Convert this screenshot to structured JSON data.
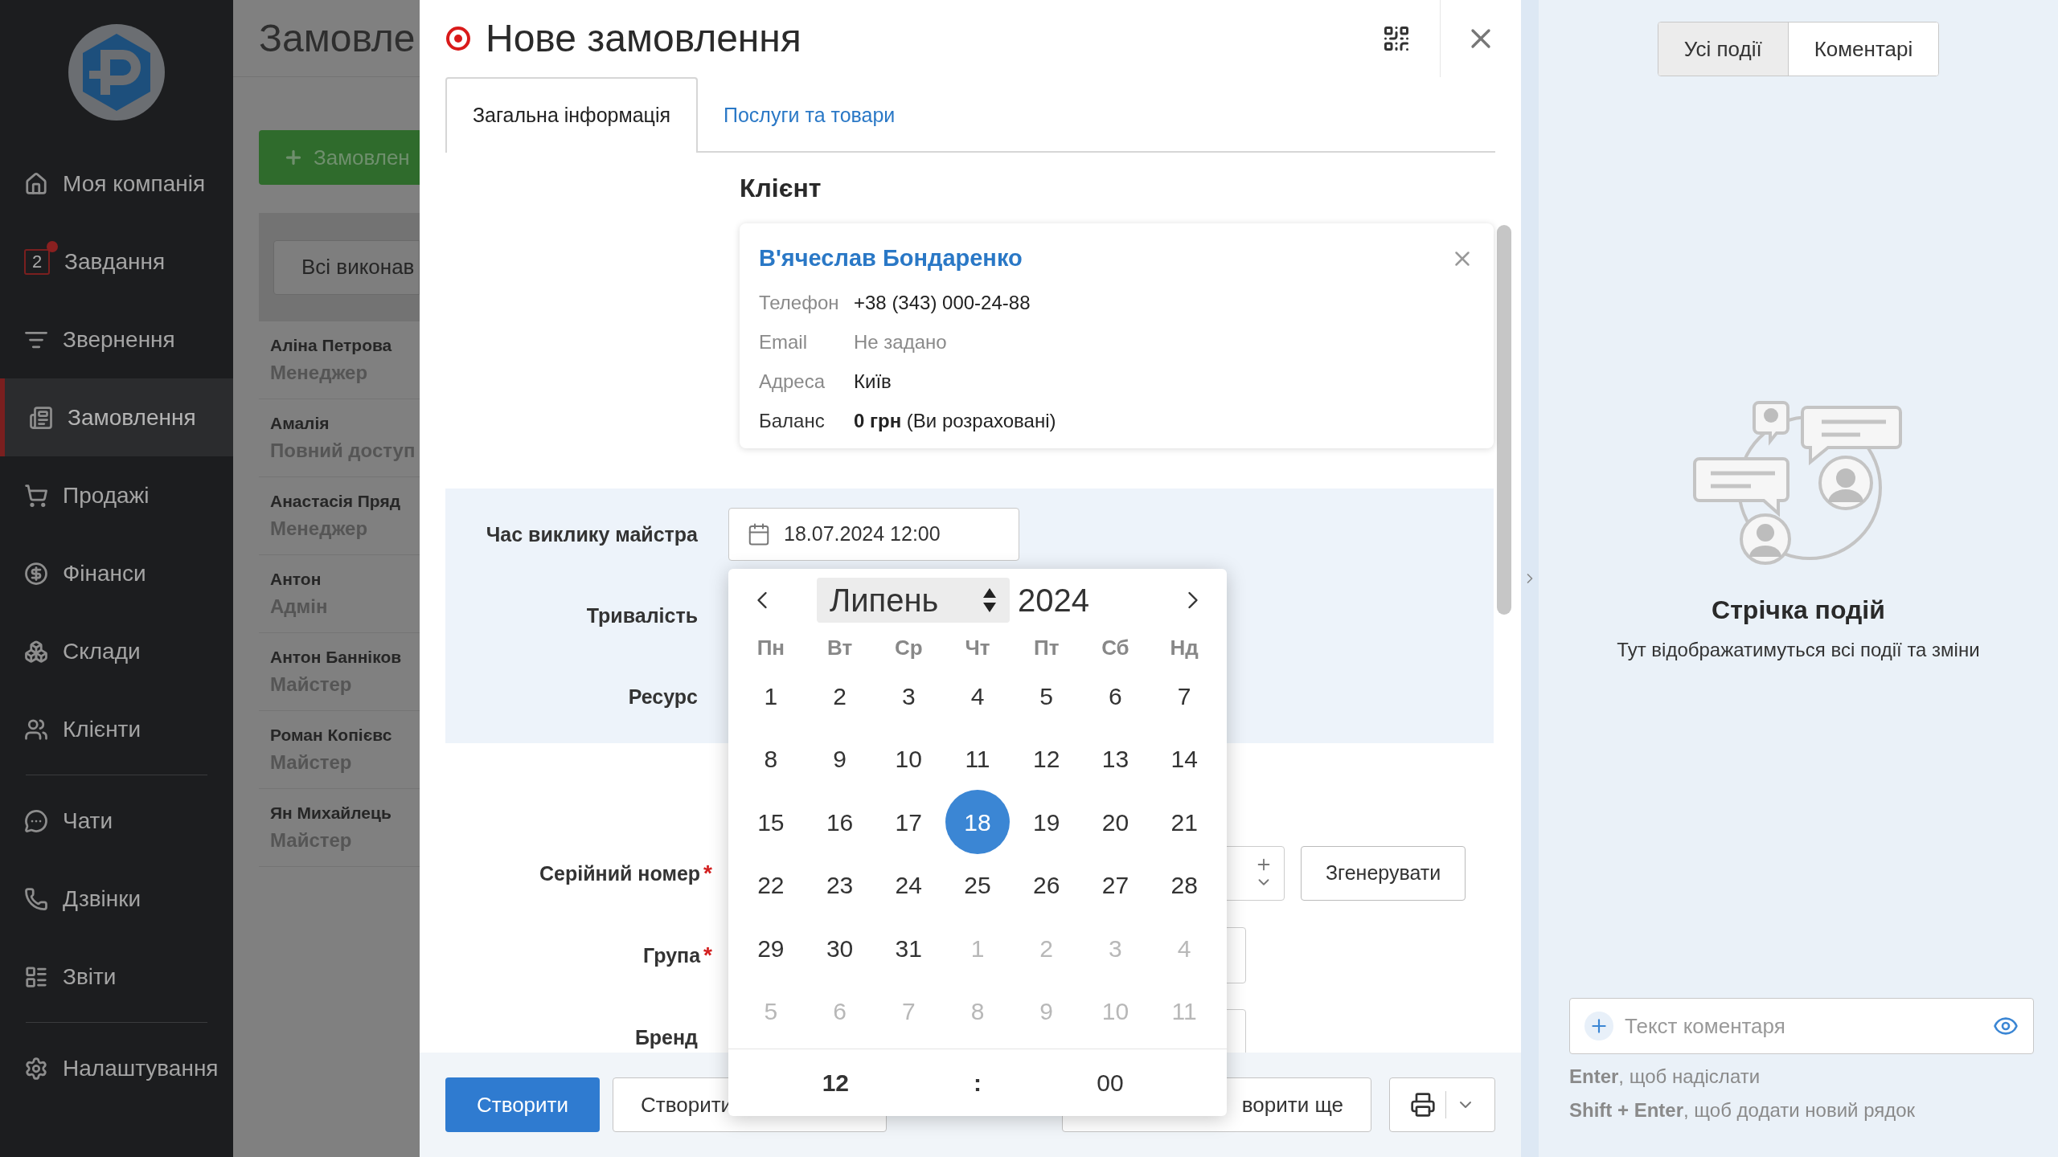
{
  "sidebar": {
    "groups": [
      [
        {
          "kind": "home",
          "label": "Моя компанія",
          "selected": false
        },
        {
          "kind": "tasks",
          "label": "Завдання",
          "badge": "2",
          "selected": false
        },
        {
          "kind": "requests",
          "label": "Звернення",
          "selected": false
        },
        {
          "kind": "orders",
          "label": "Замовлення",
          "selected": true
        },
        {
          "kind": "sales",
          "label": "Продажі",
          "selected": false
        },
        {
          "kind": "finance",
          "label": "Фінанси",
          "selected": false
        },
        {
          "kind": "warehouses",
          "label": "Склади",
          "selected": false
        },
        {
          "kind": "clients",
          "label": "Клієнти",
          "selected": false
        }
      ],
      [
        {
          "kind": "chats",
          "label": "Чати",
          "selected": false
        },
        {
          "kind": "calls",
          "label": "Дзвінки",
          "selected": false
        },
        {
          "kind": "reports",
          "label": "Звіти",
          "selected": false
        }
      ],
      [
        {
          "kind": "settings",
          "label": "Налаштування",
          "selected": false
        }
      ]
    ]
  },
  "background_page": {
    "title": "Замовле",
    "add_button": "Замовлен",
    "filter": "Всі виконав",
    "people": [
      {
        "name": "Аліна Петрова",
        "role": "Менеджер"
      },
      {
        "name": "Амалія",
        "role": "Повний доступ"
      },
      {
        "name": "Анастасія Пряд",
        "role": "Менеджер"
      },
      {
        "name": "Антон",
        "role": "Адмін"
      },
      {
        "name": "Антон Банніков",
        "role": "Майстер"
      },
      {
        "name": "Роман Копієвс",
        "role": "Майстер"
      },
      {
        "name": "Ян Михайлець",
        "role": "Майстер"
      }
    ]
  },
  "modal": {
    "title": "Нове замовлення",
    "tabs": [
      {
        "label": "Загальна інформація",
        "selected": true
      },
      {
        "label": "Послуги та товари",
        "selected": false
      }
    ],
    "client": {
      "heading": "Клієнт",
      "name": "В'ячеслав Бондаренко",
      "fields": [
        {
          "kind": "plain",
          "label": "Телефон",
          "value": "+38 (343) 000-24-88"
        },
        {
          "kind": "empty",
          "label": "Email",
          "value": "Не задано"
        },
        {
          "kind": "plain",
          "label": "Адреса",
          "value": "Київ"
        },
        {
          "kind": "balance",
          "label": "Баланс",
          "value": "**0 грн** (Ви розраховані)"
        }
      ]
    },
    "call_time": {
      "label": "Час виклику майстра",
      "value": "18.07.2024 12:00"
    },
    "highlighted_rows": [
      {
        "label": "Тривалість"
      },
      {
        "label": "Ресурс"
      }
    ],
    "rows": [
      {
        "kind": "serial",
        "label": "Серійний номер",
        "required_mark": "*",
        "action": "Згенерувати"
      },
      {
        "kind": "group",
        "label": "Група",
        "required_mark": "*"
      },
      {
        "kind": "brand",
        "label": "Бренд"
      }
    ],
    "calendar": {
      "month": "Липень",
      "year": "2024",
      "weekdays": [
        "Пн",
        "Вт",
        "Ср",
        "Чт",
        "Пт",
        "Сб",
        "Нд"
      ],
      "weeks": [
        [
          {
            "day": "1",
            "outside": false,
            "selected": false
          },
          {
            "day": "2",
            "outside": false,
            "selected": false
          },
          {
            "day": "3",
            "outside": false,
            "selected": false
          },
          {
            "day": "4",
            "outside": false,
            "selected": false
          },
          {
            "day": "5",
            "outside": false,
            "selected": false
          },
          {
            "day": "6",
            "outside": false,
            "selected": false
          },
          {
            "day": "7",
            "outside": false,
            "selected": false
          }
        ],
        [
          {
            "day": "8",
            "outside": false,
            "selected": false
          },
          {
            "day": "9",
            "outside": false,
            "selected": false
          },
          {
            "day": "10",
            "outside": false,
            "selected": false
          },
          {
            "day": "11",
            "outside": false,
            "selected": false
          },
          {
            "day": "12",
            "outside": false,
            "selected": false
          },
          {
            "day": "13",
            "outside": false,
            "selected": false
          },
          {
            "day": "14",
            "outside": false,
            "selected": false
          }
        ],
        [
          {
            "day": "15",
            "outside": false,
            "selected": false
          },
          {
            "day": "16",
            "outside": false,
            "selected": false
          },
          {
            "day": "17",
            "outside": false,
            "selected": false
          },
          {
            "day": "18",
            "outside": false,
            "selected": true
          },
          {
            "day": "19",
            "outside": false,
            "selected": false
          },
          {
            "day": "20",
            "outside": false,
            "selected": false
          },
          {
            "day": "21",
            "outside": false,
            "selected": false
          }
        ],
        [
          {
            "day": "22",
            "outside": false,
            "selected": false
          },
          {
            "day": "23",
            "outside": false,
            "selected": false
          },
          {
            "day": "24",
            "outside": false,
            "selected": false
          },
          {
            "day": "25",
            "outside": false,
            "selected": false
          },
          {
            "day": "26",
            "outside": false,
            "selected": false
          },
          {
            "day": "27",
            "outside": false,
            "selected": false
          },
          {
            "day": "28",
            "outside": false,
            "selected": false
          }
        ],
        [
          {
            "day": "29",
            "outside": false,
            "selected": false
          },
          {
            "day": "30",
            "outside": false,
            "selected": false
          },
          {
            "day": "31",
            "outside": false,
            "selected": false
          },
          {
            "day": "1",
            "outside": true,
            "selected": false
          },
          {
            "day": "2",
            "outside": true,
            "selected": false
          },
          {
            "day": "3",
            "outside": true,
            "selected": false
          },
          {
            "day": "4",
            "outside": true,
            "selected": false
          }
        ],
        [
          {
            "day": "5",
            "outside": true,
            "selected": false
          },
          {
            "day": "6",
            "outside": true,
            "selected": false
          },
          {
            "day": "7",
            "outside": true,
            "selected": false
          },
          {
            "day": "8",
            "outside": true,
            "selected": false
          },
          {
            "day": "9",
            "outside": true,
            "selected": false
          },
          {
            "day": "10",
            "outside": true,
            "selected": false
          },
          {
            "day": "11",
            "outside": true,
            "selected": false
          }
        ]
      ],
      "hour": "12",
      "separator": ":",
      "minute": "00"
    },
    "footer_buttons": [
      {
        "kind": "primary",
        "label": "Створити"
      },
      {
        "kind": "secondary",
        "label": "Створити"
      },
      {
        "kind": "secondary_end",
        "label": "ворити ще"
      }
    ]
  },
  "events_panel": {
    "tabs": [
      {
        "label": "Усі події",
        "selected": true
      },
      {
        "label": "Коментарі",
        "selected": false
      }
    ],
    "title": "Стрічка подій",
    "subtitle": "Тут відображатимуться всі події та зміни",
    "comment": {
      "placeholder": "Текст коментаря"
    },
    "hints": [
      "**Enter**, щоб надіслати",
      "**Shift + Enter**, щоб додати новий рядок"
    ]
  }
}
